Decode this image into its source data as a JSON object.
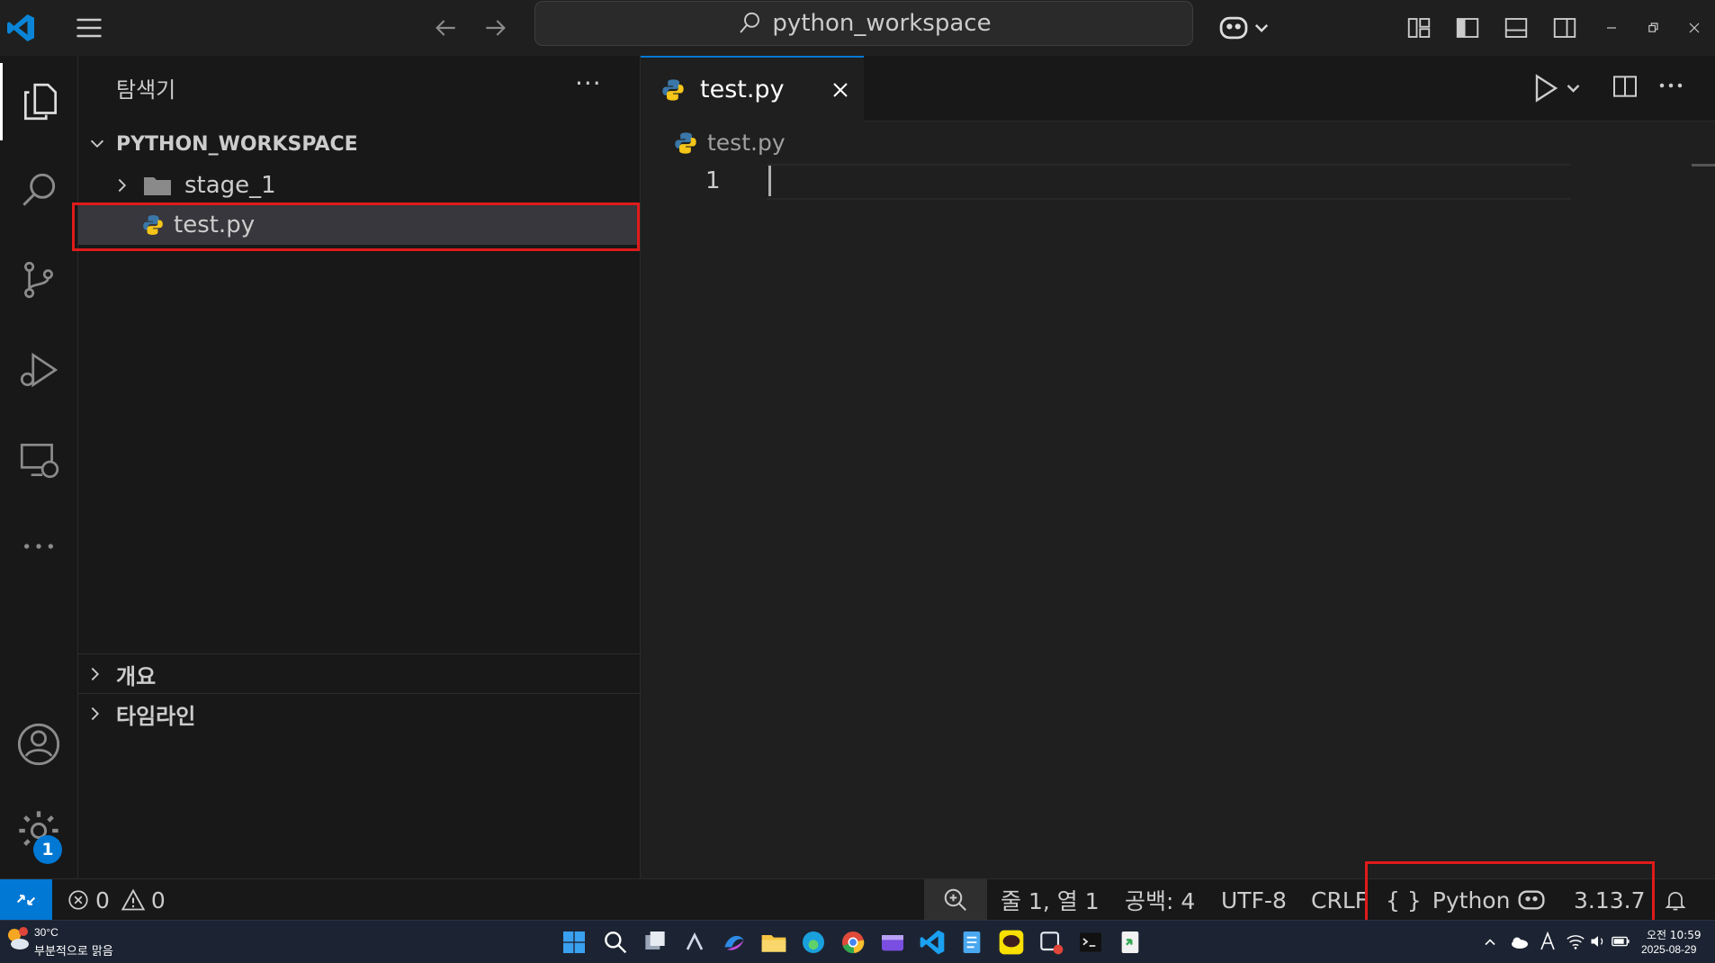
{
  "titlebar": {
    "search_text": "python_workspace"
  },
  "sidebar": {
    "title": "탐색기",
    "more": "···",
    "workspace": "PYTHON_WORKSPACE",
    "items": [
      {
        "label": "stage_1",
        "type": "folder",
        "expanded": false
      },
      {
        "label": "test.py",
        "type": "python-file",
        "selected": true
      }
    ],
    "sections": [
      {
        "label": "개요"
      },
      {
        "label": "타임라인"
      }
    ]
  },
  "activitybar": {
    "settings_badge": "1"
  },
  "editor": {
    "tab_label": "test.py",
    "breadcrumb": "test.py",
    "line_numbers": [
      "1"
    ]
  },
  "statusbar": {
    "errors": "0",
    "warnings": "0",
    "position": "줄 1, 열 1",
    "spaces": "공백: 4",
    "encoding": "UTF-8",
    "eol": "CRLF",
    "language_glyph": "{ }",
    "language": "Python",
    "python_version": "3.13.7"
  },
  "taskbar": {
    "weather_temp": "30°C",
    "weather_desc": "부분적으로 맑음",
    "clock_time": "오전 10:59",
    "clock_date": "2025-08-29"
  },
  "colors": {
    "accent": "#0078d4",
    "highlight_box": "#e01b1b",
    "background": "#1f1f1f",
    "sidebar_bg": "#181818"
  }
}
